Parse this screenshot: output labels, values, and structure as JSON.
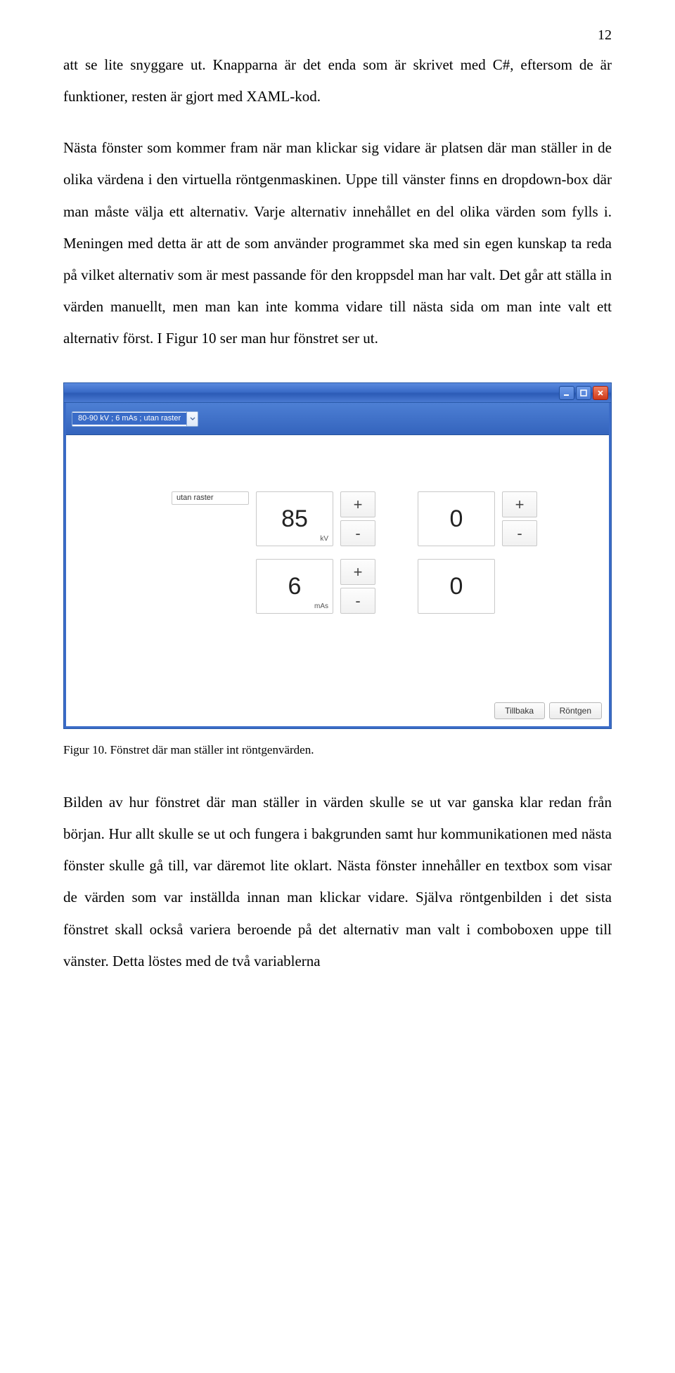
{
  "page_number": "12",
  "paragraphs": {
    "p1": "att se lite snyggare ut. Knapparna är det enda som är skrivet med C#, eftersom de är funktioner, resten är gjort med XAML-kod.",
    "p2": "Nästa fönster som kommer fram när man klickar sig vidare är platsen där man ställer in de olika värdena i den virtuella röntgenmaskinen. Uppe till vänster finns en dropdown-box där man måste välja ett alternativ. Varje alternativ innehållet en del olika värden som fylls i. Meningen med detta är att de som använder programmet ska med sin egen kunskap ta reda på vilket alternativ som är mest passande för den kroppsdel man har valt. Det går att ställa in värden manuellt, men man kan inte komma vidare till nästa sida om man inte valt ett alternativ först. I Figur 10 ser man hur fönstret ser ut.",
    "p3": "Bilden av hur fönstret där man ställer in värden skulle se ut var ganska klar redan från början. Hur allt skulle se ut och fungera i bakgrunden samt hur kommunikationen med nästa fönster skulle gå till, var däremot lite oklart. Nästa fönster innehåller en textbox som visar de värden som var inställda innan man klickar vidare. Själva röntgenbilden i det sista fönstret skall också variera beroende på det alternativ man valt i comboboxen uppe till vänster. Detta löstes med de två variablerna"
  },
  "caption": "Figur 10. Fönstret där man ställer int röntgenvärden.",
  "window": {
    "combo_selected": "80-90 kV ; 6 mAs ; utan raster",
    "raster_label": "utan raster",
    "kv_value": "85",
    "kv_unit": "kV",
    "mas_value": "6",
    "mas_unit": "mAs",
    "aux1_value": "0",
    "aux2_value": "0",
    "btn_back": "Tillbaka",
    "btn_xray": "Röntgen",
    "plus": "+",
    "minus": "-"
  }
}
